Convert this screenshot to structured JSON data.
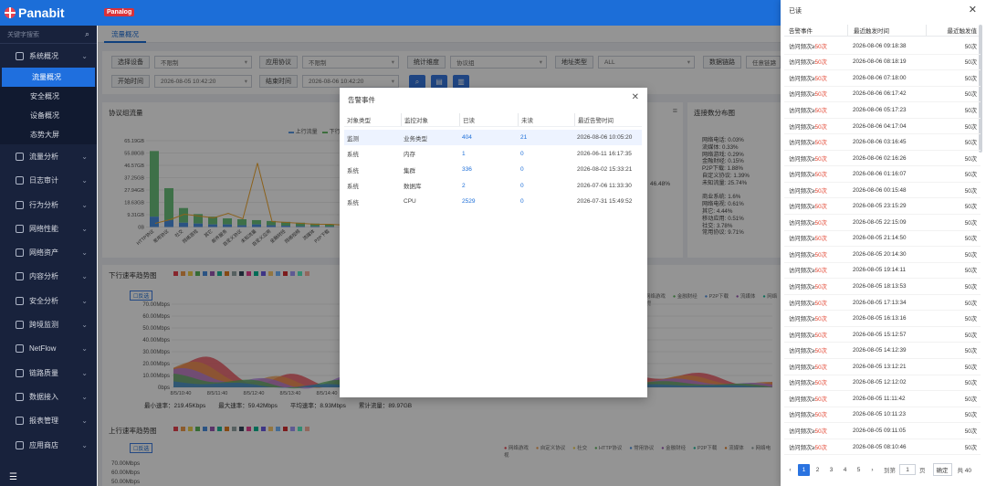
{
  "app": {
    "brand": "Panabit",
    "badge": "Panalog",
    "search_placeholder": "关键字搜索"
  },
  "sidebar": {
    "items": [
      {
        "label": "系统概况"
      },
      {
        "label": "流量分析"
      },
      {
        "label": "日志审计"
      },
      {
        "label": "行为分析"
      },
      {
        "label": "网络性能"
      },
      {
        "label": "网络资产"
      },
      {
        "label": "内容分析"
      },
      {
        "label": "安全分析"
      },
      {
        "label": "跨境监测"
      },
      {
        "label": "NetFlow"
      },
      {
        "label": "链路质量"
      },
      {
        "label": "数据接入"
      },
      {
        "label": "报表管理"
      },
      {
        "label": "应用商店"
      }
    ],
    "sub_items": [
      {
        "label": "流量概况"
      },
      {
        "label": "安全概况"
      },
      {
        "label": "设备概况"
      },
      {
        "label": "态势大屏"
      }
    ]
  },
  "tabs": {
    "active": "流量概况"
  },
  "filters": {
    "device_label": "选择设备",
    "device_value": "不限制",
    "app_label": "应用协议",
    "app_value": "不限制",
    "dim_label": "统计维度",
    "dim_value": "协议组",
    "addr_label": "地址类型",
    "addr_value": "ALL",
    "link_label": "数据链路",
    "link_value": "任意链路",
    "start_label": "开始时间",
    "start_value": "2026-08-05 10:42:20",
    "end_label": "结束时间",
    "end_value": "2026-08-06 10:42:20"
  },
  "panels": {
    "proto_title": "协议组流量",
    "legend_up": "上行流量",
    "legend_down": "下行流量",
    "yticks": [
      "65.19GB",
      "55.88GB",
      "46.57GB",
      "37.25GB",
      "27.94GB",
      "18.63GB",
      "9.31GB",
      "0B"
    ],
    "xcats": [
      "HTTP协议",
      "常用协议",
      "社交",
      "网络游戏",
      "其它",
      "邮件服务",
      "自定义协议",
      "未知流量",
      "自定义应用",
      "金融财经",
      "网络视频",
      "流媒体",
      "P2P下载"
    ],
    "pct_label": "46.48%",
    "conn_title": "连接数分布图",
    "conn_list": [
      "网络电话: 0.03%",
      "流媒体: 0.33%",
      "网络游戏: 0.29%",
      "金融财经: 0.15%",
      "P2P下载: 1.88%",
      "自定义协议: 1.39%",
      "未知流量: 25.74%",
      "",
      "商业系统: 1.6%",
      "网络电视: 0.61%",
      "其它: 4.44%",
      "移动应用: 0.51%",
      "社交: 3.78%",
      "常用协议: 9.71%"
    ],
    "down_title": "下行速率趋势图",
    "invert_label": "反选",
    "down_yticks": [
      "70.00Mbps",
      "60.00Mbps",
      "50.00Mbps",
      "40.00Mbps",
      "30.00Mbps",
      "20.00Mbps",
      "10.00Mbps",
      "0bps"
    ],
    "down_xticks": [
      "8/5/10:40",
      "8/5/11:40",
      "8/5/12:40",
      "8/5/13:40",
      "8/5/14:40",
      "8/5/15:40"
    ],
    "down_legend": [
      "网络游戏",
      "金融财经",
      "P2P下载",
      "流媒体",
      "网络电视"
    ],
    "stats": {
      "min": "最小速率：219.45Kbps",
      "max": "最大速率：59.42Mbps",
      "avg": "平均速率：8.93Mbps",
      "total": "累计流量：89.97GB"
    },
    "up_title": "上行速率趋势图",
    "up_yticks": [
      "70.00Mbps",
      "60.00Mbps",
      "50.00Mbps"
    ],
    "up_legend": [
      "网络游戏",
      "自定义协议",
      "社交",
      "HTTP协议",
      "常用协议",
      "金融财经",
      "P2P下载",
      "流媒体",
      "网络电视"
    ]
  },
  "modal": {
    "title": "告警事件",
    "columns": [
      "对象类型",
      "监控对象",
      "已读",
      "未读",
      "最近告警时间"
    ],
    "rows": [
      {
        "type": "监测",
        "obj": "业务类型",
        "read": "404",
        "unread": "21",
        "time": "2026-08-06 10:05:20"
      },
      {
        "type": "系统",
        "obj": "内存",
        "read": "1",
        "unread": "0",
        "time": "2026-06-11 16:17:35"
      },
      {
        "type": "系统",
        "obj": "集群",
        "read": "336",
        "unread": "0",
        "time": "2026-08-02 15:33:21"
      },
      {
        "type": "系统",
        "obj": "数据库",
        "read": "2",
        "unread": "0",
        "time": "2026-07-06 11:33:30"
      },
      {
        "type": "系统",
        "obj": "CPU",
        "read": "2529",
        "unread": "0",
        "time": "2026-07-31 15:49:52"
      }
    ]
  },
  "read_panel": {
    "title": "已读",
    "columns": [
      "告警事件",
      "最近触发时间",
      "最近触发值"
    ],
    "rows": [
      {
        "prefix": "访问频次≥",
        "val": "50次",
        "time": "2026-08-06 09:18:38",
        "count": "50次"
      },
      {
        "prefix": "访问频次≥",
        "val": "50次",
        "time": "2026-08-06 08:18:19",
        "count": "50次"
      },
      {
        "prefix": "访问频次≥",
        "val": "50次",
        "time": "2026-08-06 07:18:00",
        "count": "50次"
      },
      {
        "prefix": "访问频次≥",
        "val": "50次",
        "time": "2026-08-06 06:17:42",
        "count": "50次"
      },
      {
        "prefix": "访问频次≥",
        "val": "50次",
        "time": "2026-08-06 05:17:23",
        "count": "50次"
      },
      {
        "prefix": "访问频次≥",
        "val": "50次",
        "time": "2026-08-06 04:17:04",
        "count": "50次"
      },
      {
        "prefix": "访问频次≥",
        "val": "50次",
        "time": "2026-08-06 03:16:45",
        "count": "50次"
      },
      {
        "prefix": "访问频次≥",
        "val": "50次",
        "time": "2026-08-06 02:16:26",
        "count": "50次"
      },
      {
        "prefix": "访问频次≥",
        "val": "50次",
        "time": "2026-08-06 01:16:07",
        "count": "50次"
      },
      {
        "prefix": "访问频次≥",
        "val": "50次",
        "time": "2026-08-06 00:15:48",
        "count": "50次"
      },
      {
        "prefix": "访问频次≥",
        "val": "50次",
        "time": "2026-08-05 23:15:29",
        "count": "50次"
      },
      {
        "prefix": "访问频次≥",
        "val": "50次",
        "time": "2026-08-05 22:15:09",
        "count": "50次"
      },
      {
        "prefix": "访问频次≥",
        "val": "50次",
        "time": "2026-08-05 21:14:50",
        "count": "50次"
      },
      {
        "prefix": "访问频次≥",
        "val": "50次",
        "time": "2026-08-05 20:14:30",
        "count": "50次"
      },
      {
        "prefix": "访问频次≥",
        "val": "50次",
        "time": "2026-08-05 19:14:11",
        "count": "50次"
      },
      {
        "prefix": "访问频次≥",
        "val": "50次",
        "time": "2026-08-05 18:13:53",
        "count": "50次"
      },
      {
        "prefix": "访问频次≥",
        "val": "50次",
        "time": "2026-08-05 17:13:34",
        "count": "50次"
      },
      {
        "prefix": "访问频次≥",
        "val": "50次",
        "time": "2026-08-05 16:13:16",
        "count": "50次"
      },
      {
        "prefix": "访问频次≥",
        "val": "50次",
        "time": "2026-08-05 15:12:57",
        "count": "50次"
      },
      {
        "prefix": "访问频次≥",
        "val": "50次",
        "time": "2026-08-05 14:12:39",
        "count": "50次"
      },
      {
        "prefix": "访问频次≥",
        "val": "50次",
        "time": "2026-08-05 13:12:21",
        "count": "50次"
      },
      {
        "prefix": "访问频次≥",
        "val": "50次",
        "time": "2026-08-05 12:12:02",
        "count": "50次"
      },
      {
        "prefix": "访问频次≥",
        "val": "50次",
        "time": "2026-08-05 11:11:42",
        "count": "50次"
      },
      {
        "prefix": "访问频次≥",
        "val": "50次",
        "time": "2026-08-05 10:11:23",
        "count": "50次"
      },
      {
        "prefix": "访问频次≥",
        "val": "50次",
        "time": "2026-08-05 09:11:05",
        "count": "50次"
      },
      {
        "prefix": "访问频次≥",
        "val": "50次",
        "time": "2026-08-05 08:10:46",
        "count": "50次"
      }
    ],
    "pager": {
      "pages": [
        "1",
        "2",
        "3",
        "4",
        "5"
      ],
      "goto_label": "到第",
      "goto_value": "1",
      "page_unit": "页",
      "confirm": "确定",
      "total": "共 40"
    }
  }
}
